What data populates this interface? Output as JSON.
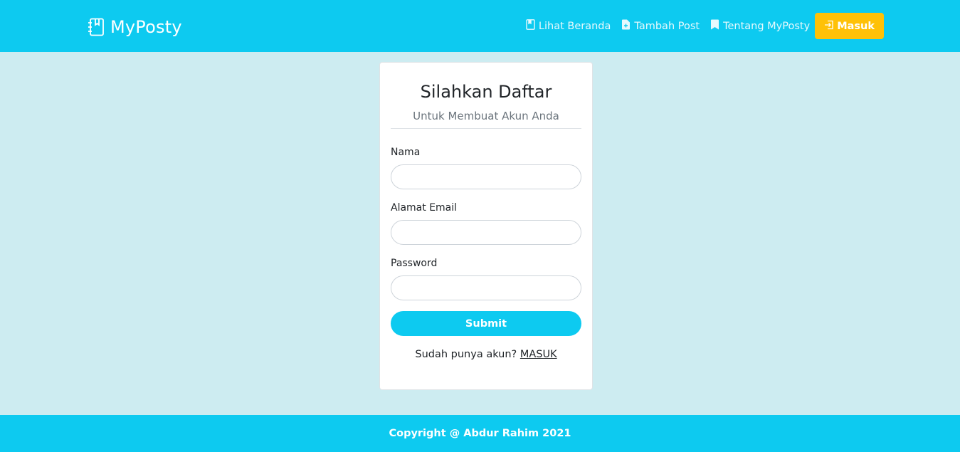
{
  "navbar": {
    "brand": "MyPosty",
    "brand_icon": "notebook-icon",
    "links": [
      {
        "label": "Lihat Beranda",
        "icon": "journal-icon"
      },
      {
        "label": "Tambah Post",
        "icon": "file-plus-icon"
      },
      {
        "label": "Tentang MyPosty",
        "icon": "bookmark-icon"
      }
    ],
    "login_button": {
      "label": "Masuk",
      "icon": "box-arrow-in-icon"
    }
  },
  "form": {
    "title": "Silahkan Daftar",
    "subtitle": "Untuk Membuat Akun Anda",
    "fields": [
      {
        "label": "Nama",
        "value": "",
        "placeholder": ""
      },
      {
        "label": "Alamat Email",
        "value": "",
        "placeholder": ""
      },
      {
        "label": "Password",
        "value": "",
        "placeholder": ""
      }
    ],
    "submit_label": "Submit",
    "login_prompt": "Sudah punya akun?",
    "login_link": "MASUK"
  },
  "footer": {
    "text": "Copyright @ Abdur Rahim 2021"
  },
  "colors": {
    "primary": "#0dcaf0",
    "warning": "#ffc107",
    "background": "#cdecf1",
    "card": "#ffffff"
  }
}
